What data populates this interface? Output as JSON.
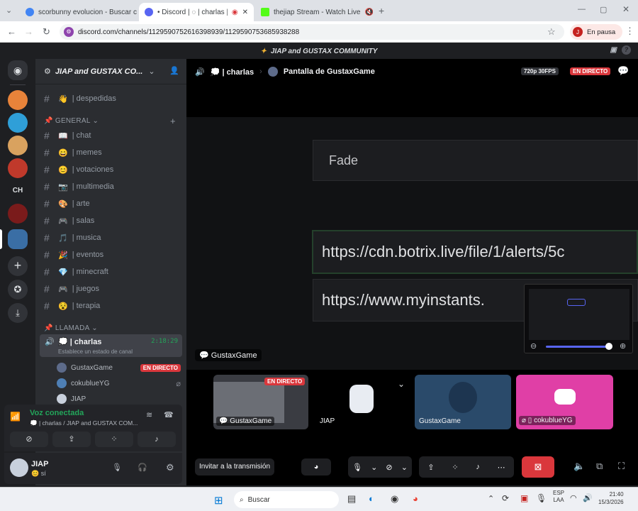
{
  "browser": {
    "tabs": [
      {
        "title": "scorbunny evolucion - Buscar c"
      },
      {
        "title": "• Discord | ◌ | charlas | JIA"
      },
      {
        "title": "thejiap Stream - Watch Live"
      }
    ],
    "url": "discord.com/channels/1129590752616398939/1129590753685938288",
    "profile_initial": "J",
    "profile_label": "En pausa"
  },
  "app_title": "JIAP and GUSTAX COMMUNITY",
  "server": {
    "name": "JIAP and GUSTAX CO..."
  },
  "channels_top": [
    {
      "icon": "👋",
      "name": "| despedidas"
    }
  ],
  "category_general": "GENERAL",
  "channels": [
    {
      "icon": "📖",
      "name": "| chat"
    },
    {
      "icon": "😄",
      "name": "| memes"
    },
    {
      "icon": "😊",
      "name": "| votaciones"
    },
    {
      "icon": "📷",
      "name": "| multimedia"
    },
    {
      "icon": "🎨",
      "name": "| arte"
    },
    {
      "icon": "🎮",
      "name": "| salas"
    },
    {
      "icon": "🎵",
      "name": "| musica"
    },
    {
      "icon": "🎉",
      "name": "| eventos"
    },
    {
      "icon": "💎",
      "name": "| minecraft"
    },
    {
      "icon": "🎮",
      "name": "| juegos"
    },
    {
      "icon": "😵",
      "name": "| terapia"
    }
  ],
  "category_voice": "LLAMADA",
  "voice_channel": {
    "name": "| charlas",
    "timer": "2:18:29",
    "status": "Establece un estado de canal"
  },
  "voice_users": [
    {
      "name": "GustaxGame",
      "badge": "EN DIRECTO"
    },
    {
      "name": "cokublueYG"
    },
    {
      "name": "JIAP"
    }
  ],
  "voice_connected": {
    "title": "Voz conectada",
    "subtitle": "| charlas / JIAP and GUSTAX COM..."
  },
  "user": {
    "name": "JIAP",
    "status": "sí"
  },
  "header": {
    "channel": "| charlas",
    "stream": "Pantalla de GustaxGame",
    "quality": "720p 30FPS",
    "live": "EN DIRECTO"
  },
  "stream_content": {
    "field1": "Fade",
    "field2": "https://cdn.botrix.live/file/1/alerts/5c",
    "field3": "https://www.myinstants."
  },
  "streamer_label": "GustaxGame",
  "tiles": [
    {
      "name": "GustaxGame",
      "badge": "EN DIRECTO"
    },
    {
      "name": "JIAP"
    },
    {
      "name": "GustaxGame"
    },
    {
      "name": "cokublueYG"
    }
  ],
  "controls": {
    "invite": "Invitar a la transmisión"
  },
  "taskbar": {
    "search": "Buscar",
    "lang": "ESP",
    "lang2": "LAA",
    "time": "21:40",
    "date": "15/3/2026"
  },
  "colors": {
    "accent": "#5865f2",
    "live": "#da373c",
    "connected": "#23a55a",
    "pink": "#eb459e"
  }
}
